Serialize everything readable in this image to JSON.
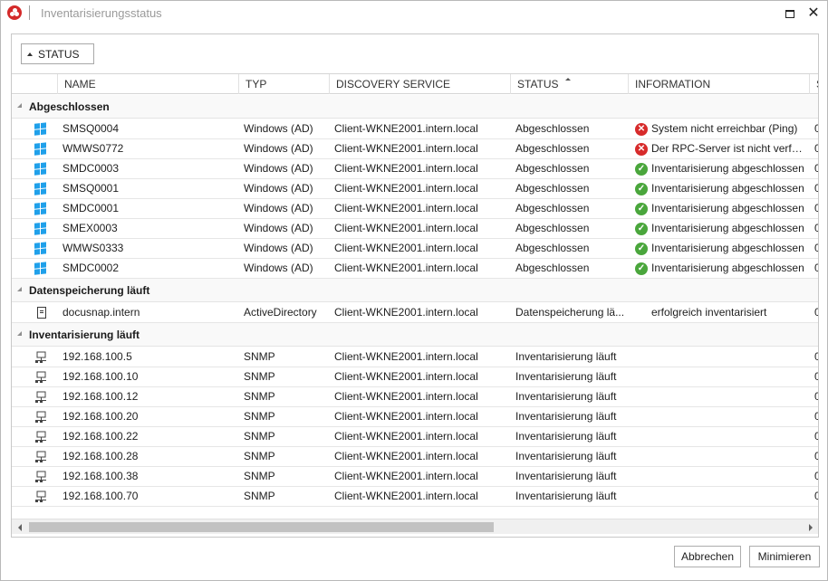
{
  "window": {
    "title": "Inventarisierungsstatus"
  },
  "grouping": {
    "chip_label": "STATUS"
  },
  "columns": [
    "NAME",
    "TYP",
    "DISCOVERY SERVICE",
    "STATUS",
    "INFORMATION",
    "S"
  ],
  "sort": {
    "column": "STATUS",
    "direction": "ascending"
  },
  "groups": [
    {
      "title": "Abgeschlossen",
      "rows": [
        {
          "icon": "windows-icon",
          "name": "SMSQ0004",
          "type": "Windows (AD)",
          "discovery": "Client-WKNE2001.intern.local",
          "status": "Abgeschlossen",
          "info_icon": "error-icon",
          "info": "System nicht erreichbar (Ping)",
          "extra": "0"
        },
        {
          "icon": "windows-icon",
          "name": "WMWS0772",
          "type": "Windows (AD)",
          "discovery": "Client-WKNE2001.intern.local",
          "status": "Abgeschlossen",
          "info_icon": "error-icon",
          "info": "Der RPC-Server ist nicht verfüg...",
          "extra": "0"
        },
        {
          "icon": "windows-icon",
          "name": "SMDC0003",
          "type": "Windows (AD)",
          "discovery": "Client-WKNE2001.intern.local",
          "status": "Abgeschlossen",
          "info_icon": "check-icon",
          "info": "Inventarisierung abgeschlossen",
          "extra": "0"
        },
        {
          "icon": "windows-icon",
          "name": "SMSQ0001",
          "type": "Windows (AD)",
          "discovery": "Client-WKNE2001.intern.local",
          "status": "Abgeschlossen",
          "info_icon": "check-icon",
          "info": "Inventarisierung abgeschlossen",
          "extra": "0"
        },
        {
          "icon": "windows-icon",
          "name": "SMDC0001",
          "type": "Windows (AD)",
          "discovery": "Client-WKNE2001.intern.local",
          "status": "Abgeschlossen",
          "info_icon": "check-icon",
          "info": "Inventarisierung abgeschlossen",
          "extra": "0"
        },
        {
          "icon": "windows-icon",
          "name": "SMEX0003",
          "type": "Windows (AD)",
          "discovery": "Client-WKNE2001.intern.local",
          "status": "Abgeschlossen",
          "info_icon": "check-icon",
          "info": "Inventarisierung abgeschlossen",
          "extra": "0"
        },
        {
          "icon": "windows-icon",
          "name": "WMWS0333",
          "type": "Windows (AD)",
          "discovery": "Client-WKNE2001.intern.local",
          "status": "Abgeschlossen",
          "info_icon": "check-icon",
          "info": "Inventarisierung abgeschlossen",
          "extra": "0"
        },
        {
          "icon": "windows-icon",
          "name": "SMDC0002",
          "type": "Windows (AD)",
          "discovery": "Client-WKNE2001.intern.local",
          "status": "Abgeschlossen",
          "info_icon": "check-icon",
          "info": "Inventarisierung abgeschlossen",
          "extra": "0"
        }
      ]
    },
    {
      "title": "Datenspeicherung läuft",
      "rows": [
        {
          "icon": "document-icon",
          "name": "docusnap.intern",
          "type": "ActiveDirectory",
          "discovery": "Client-WKNE2001.intern.local",
          "status": "Datenspeicherung lä...",
          "info_icon": "",
          "info": "erfolgreich inventarisiert",
          "extra": "0"
        }
      ]
    },
    {
      "title": "Inventarisierung läuft",
      "rows": [
        {
          "icon": "network-device-icon",
          "name": "192.168.100.5",
          "type": "SNMP",
          "discovery": "Client-WKNE2001.intern.local",
          "status": "Inventarisierung läuft",
          "info_icon": "",
          "info": "",
          "extra": "0"
        },
        {
          "icon": "network-device-icon",
          "name": "192.168.100.10",
          "type": "SNMP",
          "discovery": "Client-WKNE2001.intern.local",
          "status": "Inventarisierung läuft",
          "info_icon": "",
          "info": "",
          "extra": "0"
        },
        {
          "icon": "network-device-icon",
          "name": "192.168.100.12",
          "type": "SNMP",
          "discovery": "Client-WKNE2001.intern.local",
          "status": "Inventarisierung läuft",
          "info_icon": "",
          "info": "",
          "extra": "0"
        },
        {
          "icon": "network-device-icon",
          "name": "192.168.100.20",
          "type": "SNMP",
          "discovery": "Client-WKNE2001.intern.local",
          "status": "Inventarisierung läuft",
          "info_icon": "",
          "info": "",
          "extra": "0"
        },
        {
          "icon": "network-device-icon",
          "name": "192.168.100.22",
          "type": "SNMP",
          "discovery": "Client-WKNE2001.intern.local",
          "status": "Inventarisierung läuft",
          "info_icon": "",
          "info": "",
          "extra": "0"
        },
        {
          "icon": "network-device-icon",
          "name": "192.168.100.28",
          "type": "SNMP",
          "discovery": "Client-WKNE2001.intern.local",
          "status": "Inventarisierung läuft",
          "info_icon": "",
          "info": "",
          "extra": "0"
        },
        {
          "icon": "network-device-icon",
          "name": "192.168.100.38",
          "type": "SNMP",
          "discovery": "Client-WKNE2001.intern.local",
          "status": "Inventarisierung läuft",
          "info_icon": "",
          "info": "",
          "extra": "0"
        },
        {
          "icon": "network-device-icon",
          "name": "192.168.100.70",
          "type": "SNMP",
          "discovery": "Client-WKNE2001.intern.local",
          "status": "Inventarisierung läuft",
          "info_icon": "",
          "info": "",
          "extra": "0"
        }
      ]
    }
  ],
  "buttons": {
    "cancel": "Abbrechen",
    "minimize": "Minimieren"
  },
  "colors": {
    "windows_icon": "#1fa0ea",
    "error": "#d72b2b",
    "success": "#4aa63c"
  }
}
